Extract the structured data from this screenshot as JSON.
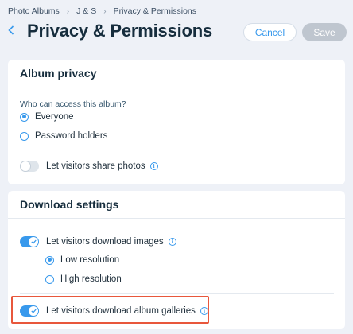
{
  "breadcrumb": [
    "Photo Albums",
    "J & S",
    "Privacy & Permissions"
  ],
  "header": {
    "title": "Privacy & Permissions",
    "cancel_label": "Cancel",
    "save_label": "Save"
  },
  "album_privacy": {
    "title": "Album privacy",
    "question": "Who can access this album?",
    "options": [
      {
        "label": "Everyone",
        "selected": true
      },
      {
        "label": "Password holders",
        "selected": false
      }
    ],
    "share_toggle": {
      "label": "Let visitors share photos",
      "on": false
    }
  },
  "download_settings": {
    "title": "Download settings",
    "download_images": {
      "label": "Let visitors download images",
      "on": true
    },
    "resolution_options": [
      {
        "label": "Low resolution",
        "selected": true
      },
      {
        "label": "High resolution",
        "selected": false
      }
    ],
    "download_galleries": {
      "label": "Let visitors download album galleries",
      "on": true
    }
  },
  "colors": {
    "accent": "#3899ec",
    "highlight": "#e8573c",
    "background": "#eef1f7"
  }
}
